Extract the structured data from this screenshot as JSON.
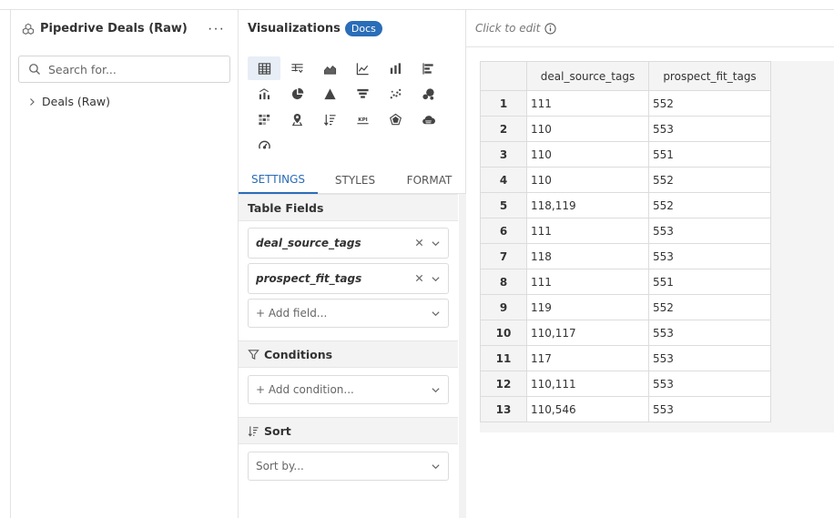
{
  "left_panel": {
    "title": "Pipedrive Deals (Raw)",
    "more_label": "···",
    "search_placeholder": "Search for...",
    "tree_items": [
      {
        "label": "Deals (Raw)"
      }
    ]
  },
  "viz_panel": {
    "title": "Visualizations",
    "docs_label": "Docs",
    "chart_types": [
      "table-icon",
      "pivot-table-icon",
      "area-chart-icon",
      "line-chart-icon",
      "bar-chart-icon",
      "horizontal-bar-icon",
      "combo-chart-icon",
      "pie-chart-icon",
      "pyramid-icon",
      "funnel-icon",
      "scatter-icon",
      "bubble-icon",
      "heatmap-icon",
      "map-marker-icon",
      "sorted-list-icon",
      "kpi-icon",
      "radar-icon",
      "word-cloud-icon",
      "gauge-icon"
    ],
    "active_chart": "table-icon",
    "tabs": [
      {
        "label": "SETTINGS",
        "active": true
      },
      {
        "label": "STYLES",
        "active": false
      },
      {
        "label": "FORMAT",
        "active": false
      }
    ],
    "table_fields_label": "Table Fields",
    "fields": [
      {
        "label": "deal_source_tags"
      },
      {
        "label": "prospect_fit_tags"
      }
    ],
    "add_field_label": "+ Add field...",
    "conditions_label": "Conditions",
    "add_condition_label": "+ Add condition...",
    "sort_label": "Sort",
    "sort_placeholder": "Sort by..."
  },
  "canvas": {
    "title_placeholder": "Click to edit",
    "accent_color": "#2a6db8"
  },
  "table": {
    "columns": [
      "deal_source_tags",
      "prospect_fit_tags"
    ],
    "rows": [
      {
        "idx": "1",
        "c1": "111",
        "c2": "552"
      },
      {
        "idx": "2",
        "c1": "110",
        "c2": "553"
      },
      {
        "idx": "3",
        "c1": "110",
        "c2": "551"
      },
      {
        "idx": "4",
        "c1": "110",
        "c2": "552"
      },
      {
        "idx": "5",
        "c1": "118,119",
        "c2": "552"
      },
      {
        "idx": "6",
        "c1": "111",
        "c2": "553"
      },
      {
        "idx": "7",
        "c1": "118",
        "c2": "553"
      },
      {
        "idx": "8",
        "c1": "111",
        "c2": "551"
      },
      {
        "idx": "9",
        "c1": "119",
        "c2": "552"
      },
      {
        "idx": "10",
        "c1": "110,117",
        "c2": "553"
      },
      {
        "idx": "11",
        "c1": "117",
        "c2": "553"
      },
      {
        "idx": "12",
        "c1": "110,111",
        "c2": "553"
      },
      {
        "idx": "13",
        "c1": "110,546",
        "c2": "553"
      }
    ]
  }
}
